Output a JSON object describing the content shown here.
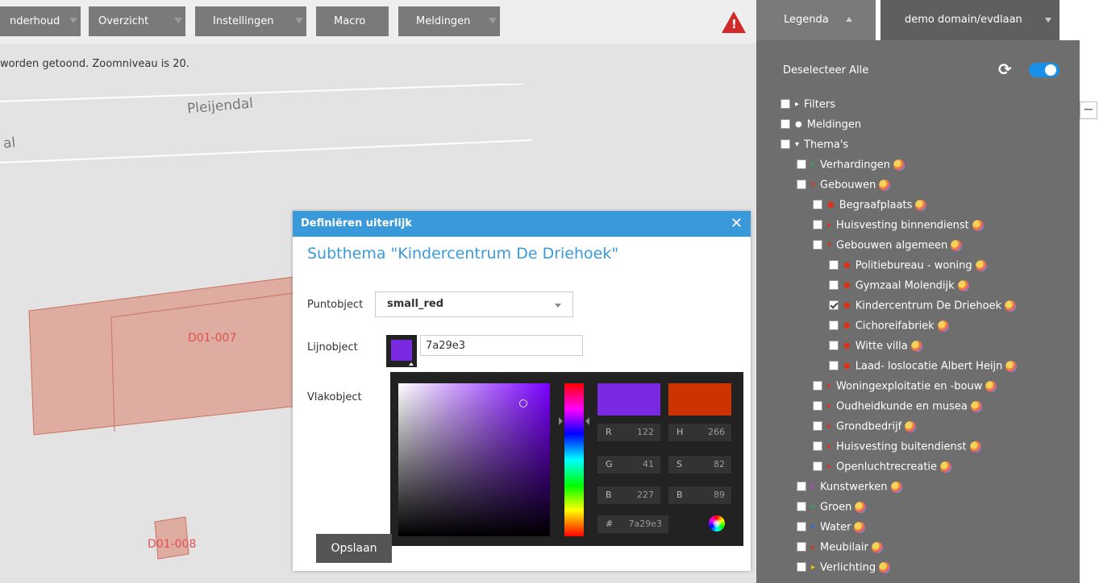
{
  "toolbar": {
    "buttons": [
      {
        "label": "nderhoud"
      },
      {
        "label": "Overzicht"
      },
      {
        "label": "Instellingen"
      },
      {
        "label": "Macro"
      },
      {
        "label": "Meldingen"
      }
    ],
    "warning": "!"
  },
  "status": {
    "text": "worden getoond. Zoomniveau is 20."
  },
  "map": {
    "street_name": "Pleijendal",
    "street_fragment": "al",
    "parcels": [
      {
        "label": "D01-007"
      },
      {
        "label": "D01-008"
      }
    ]
  },
  "panel": {
    "tabs": [
      {
        "label": "Legenda"
      },
      {
        "label": "demo domain/evdlaan"
      }
    ],
    "deselect_label": "Deselecteer Alle",
    "tree": [
      {
        "label": "Filters",
        "marker": "▸",
        "color": "#ffffff",
        "checked": false,
        "palette": false
      },
      {
        "label": "Meldingen",
        "marker": "●",
        "color": "#ffffff",
        "checked": false,
        "palette": false
      },
      {
        "label": "Thema's",
        "marker": "▾",
        "color": "#ffffff",
        "checked": false,
        "palette": false
      },
      {
        "label": "Verhardingen",
        "marker": "▸",
        "color": "#2ea44f",
        "checked": false,
        "palette": true
      },
      {
        "label": "Gebouwen",
        "marker": "▾",
        "color": "#d9331a",
        "checked": false,
        "palette": true
      },
      {
        "label": "Begraafplaats",
        "marker": "●",
        "color": "#d9331a",
        "checked": false,
        "palette": true
      },
      {
        "label": "Huisvesting binnendienst",
        "marker": "▸",
        "color": "#d9331a",
        "checked": false,
        "palette": true
      },
      {
        "label": "Gebouwen algemeen",
        "marker": "▾",
        "color": "#d9331a",
        "checked": false,
        "palette": true
      },
      {
        "label": "Politiebureau - woning",
        "marker": "●",
        "color": "#d9331a",
        "checked": false,
        "palette": true
      },
      {
        "label": "Gymzaal Molendijk",
        "marker": "●",
        "color": "#d9331a",
        "checked": false,
        "palette": true
      },
      {
        "label": "Kindercentrum De Driehoek",
        "marker": "●",
        "color": "#d9331a",
        "checked": true,
        "palette": true
      },
      {
        "label": "Cichoreifabriek",
        "marker": "●",
        "color": "#d9331a",
        "checked": false,
        "palette": true
      },
      {
        "label": "Witte villa",
        "marker": "●",
        "color": "#d9331a",
        "checked": false,
        "palette": true
      },
      {
        "label": "Laad- loslocatie Albert Heijn",
        "marker": "●",
        "color": "#d9331a",
        "checked": false,
        "palette": true
      },
      {
        "label": "Woningexploitatie en -bouw",
        "marker": "▸",
        "color": "#d9331a",
        "checked": false,
        "palette": true
      },
      {
        "label": "Oudheidkunde en musea",
        "marker": "▸",
        "color": "#d9331a",
        "checked": false,
        "palette": true
      },
      {
        "label": "Grondbedrijf",
        "marker": "▸",
        "color": "#d9331a",
        "checked": false,
        "palette": true
      },
      {
        "label": "Huisvesting buitendienst",
        "marker": "▸",
        "color": "#d9331a",
        "checked": false,
        "palette": true
      },
      {
        "label": "Openluchtrecreatie",
        "marker": "▸",
        "color": "#d9331a",
        "checked": false,
        "palette": true
      },
      {
        "label": "Kunstwerken",
        "marker": "▸",
        "color": "#c03cd6",
        "checked": false,
        "palette": true
      },
      {
        "label": "Groen",
        "marker": "▸",
        "color": "#2ea44f",
        "checked": false,
        "palette": true
      },
      {
        "label": "Water",
        "marker": "▸",
        "color": "#2a6fd9",
        "checked": false,
        "palette": true
      },
      {
        "label": "Meubilair",
        "marker": "▸",
        "color": "#d9331a",
        "checked": false,
        "palette": true
      },
      {
        "label": "Verlichting",
        "marker": "▸",
        "color": "#f2c200",
        "checked": false,
        "palette": true
      }
    ]
  },
  "dialog": {
    "header": "Definiëren uiterlijk",
    "close": "✕",
    "subtitle": "Subthema \"Kindercentrum De Driehoek\"",
    "punt_label": "Puntobject",
    "punt_value": "small_red",
    "lijn_label": "Lijnobject",
    "lijn_hex": "7a29e3",
    "vlak_label": "Vlakobject",
    "save_label": "Opslaan"
  },
  "picker": {
    "new_color": "#7a29e3",
    "old_color": "#cc3300",
    "fields": [
      {
        "key": "R",
        "value": "122"
      },
      {
        "key": "H",
        "value": "266"
      },
      {
        "key": "G",
        "value": "41"
      },
      {
        "key": "S",
        "value": "82"
      },
      {
        "key": "B",
        "value": "227"
      },
      {
        "key": "B",
        "value": "89"
      }
    ],
    "hex_key": "#",
    "hex_value": "7a29e3"
  }
}
